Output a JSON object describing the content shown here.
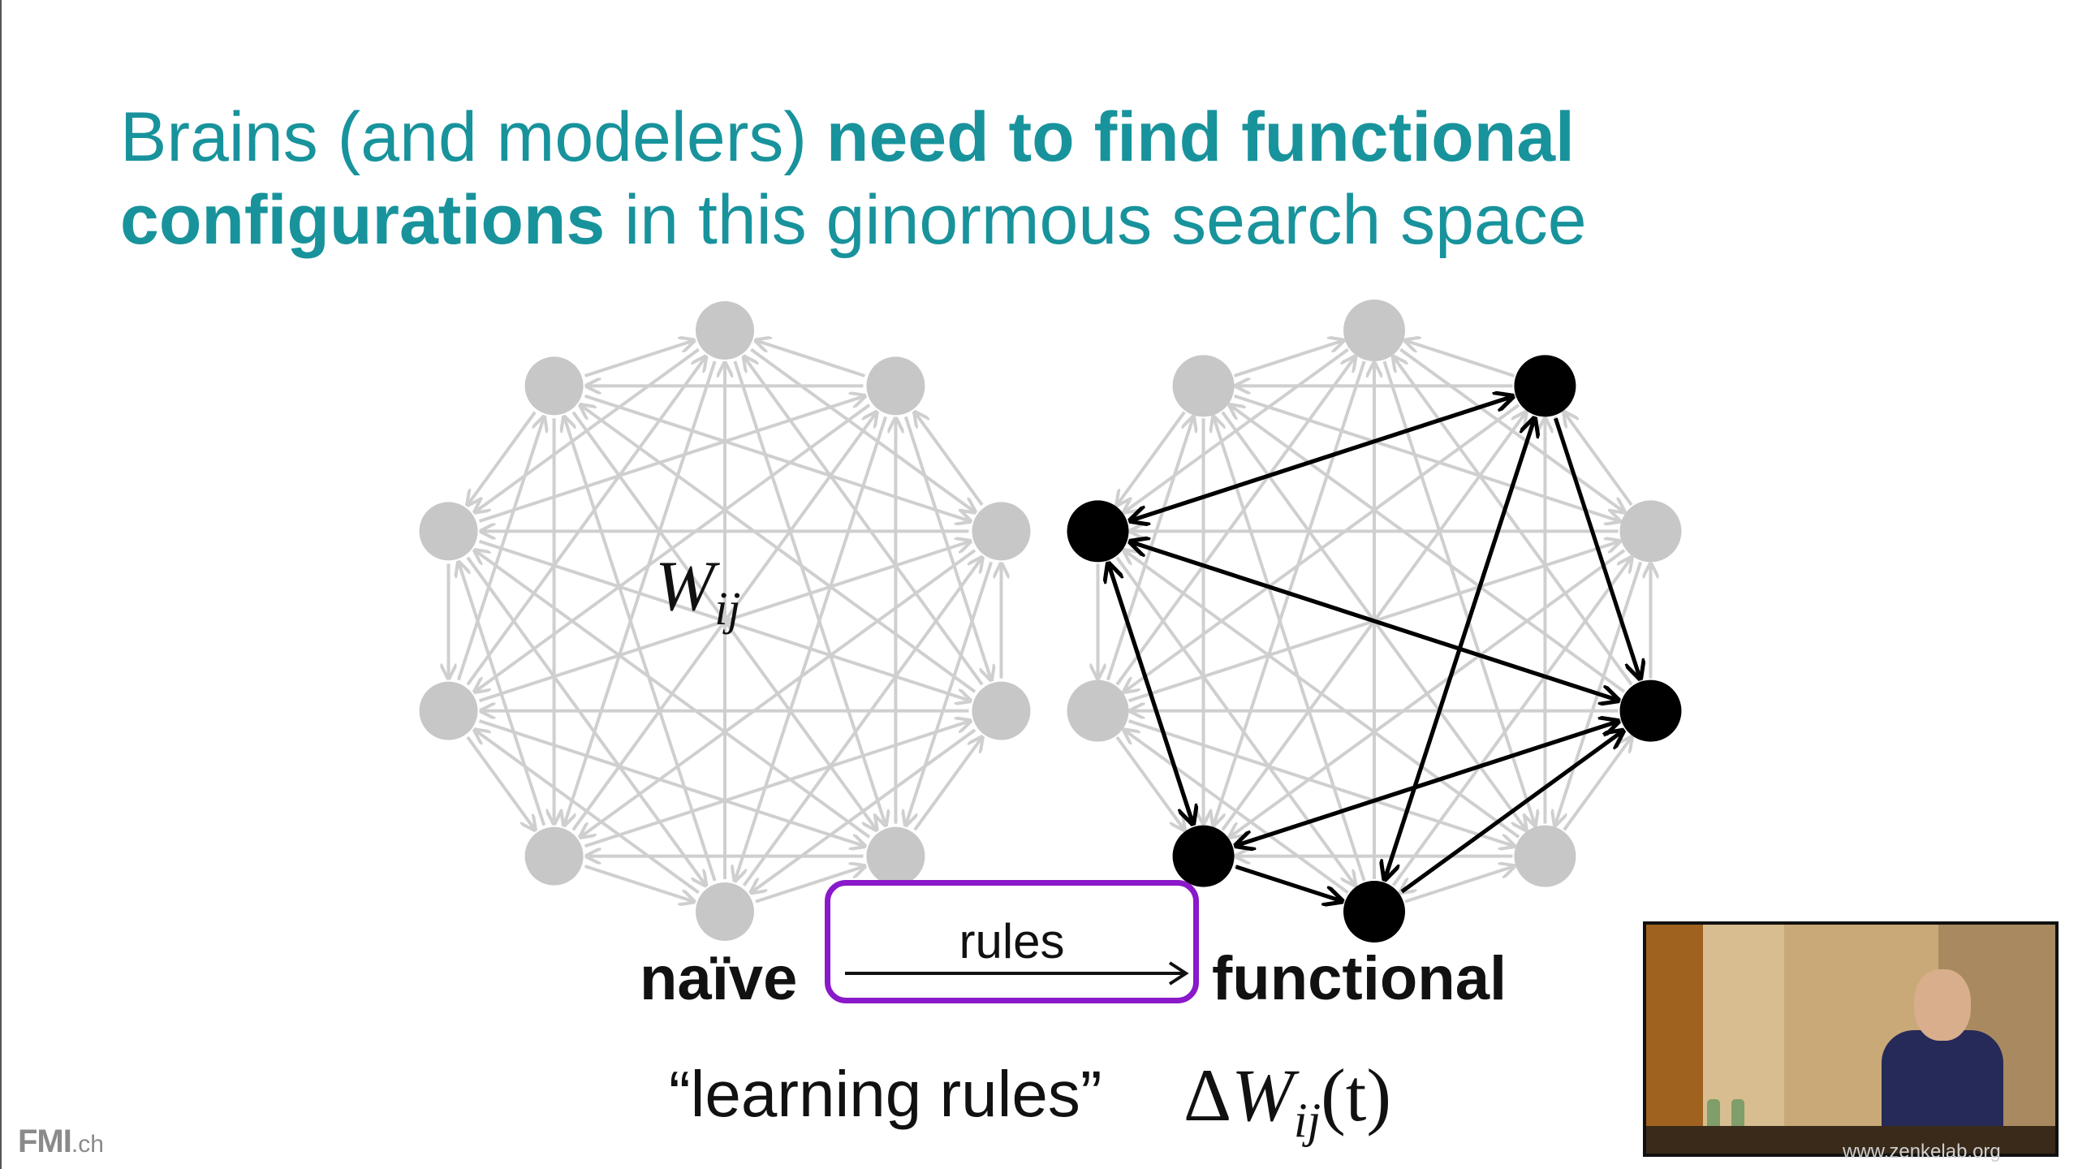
{
  "title": {
    "part1": "Brains (and modelers) ",
    "part2_bold": "need to find functional",
    "part3_bold": "configurations",
    "part4": " in this ginormous search space"
  },
  "graph_left": {
    "label_main": "W",
    "label_sub": "ij"
  },
  "colors": {
    "title": "#18939c",
    "node_gray": "#c7c7c7",
    "edge_gray": "#cfcfcf",
    "active": "#000000",
    "rules_box": "#8a19c9"
  },
  "transition": {
    "from": "naïve",
    "rules": "rules",
    "to": "functional"
  },
  "bottom": {
    "learning_rules": "“learning rules”",
    "delta": "Δ",
    "w": "W",
    "w_sub": "ij",
    "t": "(t)"
  },
  "logo": {
    "name": "FMI",
    "tld": ".ch"
  },
  "video_overlay": {
    "caption": "www.zenkelab.org"
  }
}
